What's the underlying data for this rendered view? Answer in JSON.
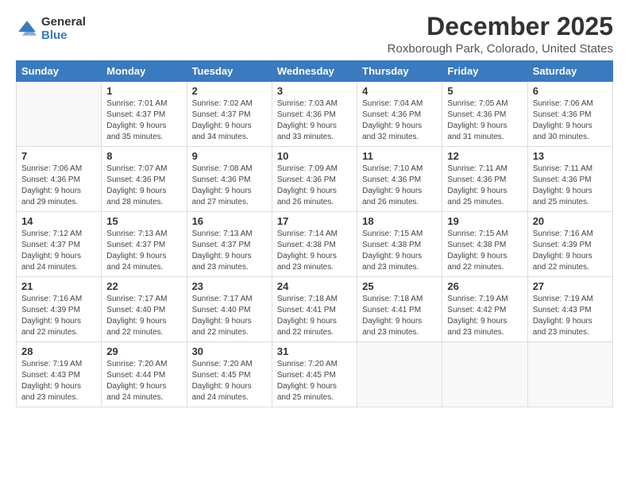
{
  "logo": {
    "general": "General",
    "blue": "Blue"
  },
  "title": "December 2025",
  "subtitle": "Roxborough Park, Colorado, United States",
  "days_of_week": [
    "Sunday",
    "Monday",
    "Tuesday",
    "Wednesday",
    "Thursday",
    "Friday",
    "Saturday"
  ],
  "weeks": [
    [
      {
        "day": "",
        "sunrise": "",
        "sunset": "",
        "daylight": ""
      },
      {
        "day": "1",
        "sunrise": "Sunrise: 7:01 AM",
        "sunset": "Sunset: 4:37 PM",
        "daylight": "Daylight: 9 hours and 35 minutes."
      },
      {
        "day": "2",
        "sunrise": "Sunrise: 7:02 AM",
        "sunset": "Sunset: 4:37 PM",
        "daylight": "Daylight: 9 hours and 34 minutes."
      },
      {
        "day": "3",
        "sunrise": "Sunrise: 7:03 AM",
        "sunset": "Sunset: 4:36 PM",
        "daylight": "Daylight: 9 hours and 33 minutes."
      },
      {
        "day": "4",
        "sunrise": "Sunrise: 7:04 AM",
        "sunset": "Sunset: 4:36 PM",
        "daylight": "Daylight: 9 hours and 32 minutes."
      },
      {
        "day": "5",
        "sunrise": "Sunrise: 7:05 AM",
        "sunset": "Sunset: 4:36 PM",
        "daylight": "Daylight: 9 hours and 31 minutes."
      },
      {
        "day": "6",
        "sunrise": "Sunrise: 7:06 AM",
        "sunset": "Sunset: 4:36 PM",
        "daylight": "Daylight: 9 hours and 30 minutes."
      }
    ],
    [
      {
        "day": "7",
        "sunrise": "Sunrise: 7:06 AM",
        "sunset": "Sunset: 4:36 PM",
        "daylight": "Daylight: 9 hours and 29 minutes."
      },
      {
        "day": "8",
        "sunrise": "Sunrise: 7:07 AM",
        "sunset": "Sunset: 4:36 PM",
        "daylight": "Daylight: 9 hours and 28 minutes."
      },
      {
        "day": "9",
        "sunrise": "Sunrise: 7:08 AM",
        "sunset": "Sunset: 4:36 PM",
        "daylight": "Daylight: 9 hours and 27 minutes."
      },
      {
        "day": "10",
        "sunrise": "Sunrise: 7:09 AM",
        "sunset": "Sunset: 4:36 PM",
        "daylight": "Daylight: 9 hours and 26 minutes."
      },
      {
        "day": "11",
        "sunrise": "Sunrise: 7:10 AM",
        "sunset": "Sunset: 4:36 PM",
        "daylight": "Daylight: 9 hours and 26 minutes."
      },
      {
        "day": "12",
        "sunrise": "Sunrise: 7:11 AM",
        "sunset": "Sunset: 4:36 PM",
        "daylight": "Daylight: 9 hours and 25 minutes."
      },
      {
        "day": "13",
        "sunrise": "Sunrise: 7:11 AM",
        "sunset": "Sunset: 4:36 PM",
        "daylight": "Daylight: 9 hours and 25 minutes."
      }
    ],
    [
      {
        "day": "14",
        "sunrise": "Sunrise: 7:12 AM",
        "sunset": "Sunset: 4:37 PM",
        "daylight": "Daylight: 9 hours and 24 minutes."
      },
      {
        "day": "15",
        "sunrise": "Sunrise: 7:13 AM",
        "sunset": "Sunset: 4:37 PM",
        "daylight": "Daylight: 9 hours and 24 minutes."
      },
      {
        "day": "16",
        "sunrise": "Sunrise: 7:13 AM",
        "sunset": "Sunset: 4:37 PM",
        "daylight": "Daylight: 9 hours and 23 minutes."
      },
      {
        "day": "17",
        "sunrise": "Sunrise: 7:14 AM",
        "sunset": "Sunset: 4:38 PM",
        "daylight": "Daylight: 9 hours and 23 minutes."
      },
      {
        "day": "18",
        "sunrise": "Sunrise: 7:15 AM",
        "sunset": "Sunset: 4:38 PM",
        "daylight": "Daylight: 9 hours and 23 minutes."
      },
      {
        "day": "19",
        "sunrise": "Sunrise: 7:15 AM",
        "sunset": "Sunset: 4:38 PM",
        "daylight": "Daylight: 9 hours and 22 minutes."
      },
      {
        "day": "20",
        "sunrise": "Sunrise: 7:16 AM",
        "sunset": "Sunset: 4:39 PM",
        "daylight": "Daylight: 9 hours and 22 minutes."
      }
    ],
    [
      {
        "day": "21",
        "sunrise": "Sunrise: 7:16 AM",
        "sunset": "Sunset: 4:39 PM",
        "daylight": "Daylight: 9 hours and 22 minutes."
      },
      {
        "day": "22",
        "sunrise": "Sunrise: 7:17 AM",
        "sunset": "Sunset: 4:40 PM",
        "daylight": "Daylight: 9 hours and 22 minutes."
      },
      {
        "day": "23",
        "sunrise": "Sunrise: 7:17 AM",
        "sunset": "Sunset: 4:40 PM",
        "daylight": "Daylight: 9 hours and 22 minutes."
      },
      {
        "day": "24",
        "sunrise": "Sunrise: 7:18 AM",
        "sunset": "Sunset: 4:41 PM",
        "daylight": "Daylight: 9 hours and 22 minutes."
      },
      {
        "day": "25",
        "sunrise": "Sunrise: 7:18 AM",
        "sunset": "Sunset: 4:41 PM",
        "daylight": "Daylight: 9 hours and 23 minutes."
      },
      {
        "day": "26",
        "sunrise": "Sunrise: 7:19 AM",
        "sunset": "Sunset: 4:42 PM",
        "daylight": "Daylight: 9 hours and 23 minutes."
      },
      {
        "day": "27",
        "sunrise": "Sunrise: 7:19 AM",
        "sunset": "Sunset: 4:43 PM",
        "daylight": "Daylight: 9 hours and 23 minutes."
      }
    ],
    [
      {
        "day": "28",
        "sunrise": "Sunrise: 7:19 AM",
        "sunset": "Sunset: 4:43 PM",
        "daylight": "Daylight: 9 hours and 23 minutes."
      },
      {
        "day": "29",
        "sunrise": "Sunrise: 7:20 AM",
        "sunset": "Sunset: 4:44 PM",
        "daylight": "Daylight: 9 hours and 24 minutes."
      },
      {
        "day": "30",
        "sunrise": "Sunrise: 7:20 AM",
        "sunset": "Sunset: 4:45 PM",
        "daylight": "Daylight: 9 hours and 24 minutes."
      },
      {
        "day": "31",
        "sunrise": "Sunrise: 7:20 AM",
        "sunset": "Sunset: 4:45 PM",
        "daylight": "Daylight: 9 hours and 25 minutes."
      },
      {
        "day": "",
        "sunrise": "",
        "sunset": "",
        "daylight": ""
      },
      {
        "day": "",
        "sunrise": "",
        "sunset": "",
        "daylight": ""
      },
      {
        "day": "",
        "sunrise": "",
        "sunset": "",
        "daylight": ""
      }
    ]
  ]
}
